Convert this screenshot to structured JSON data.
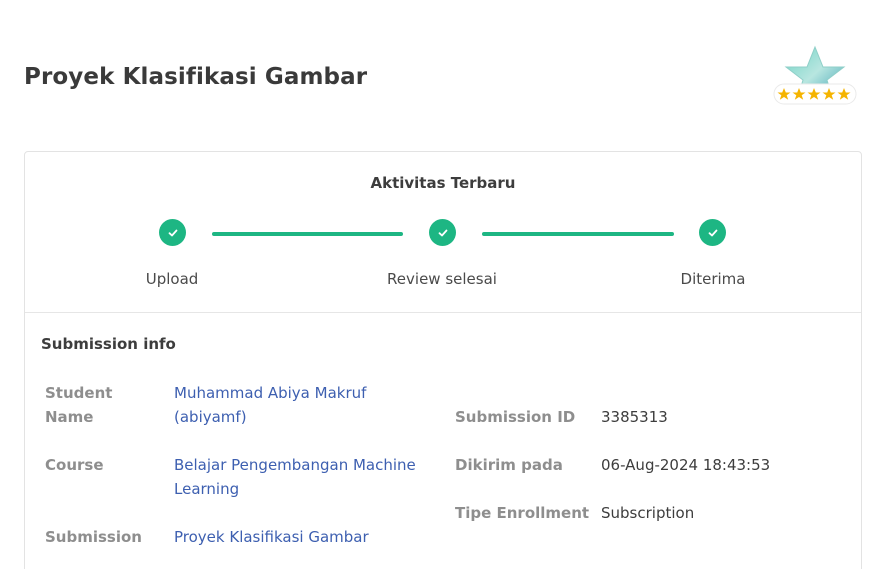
{
  "page": {
    "title": "Proyek Klasifikasi Gambar"
  },
  "badge": {
    "icon": "star-rating-badge-icon",
    "stars": 5
  },
  "activity": {
    "title": "Aktivitas Terbaru",
    "steps": [
      {
        "label": "Upload"
      },
      {
        "label": "Review selesai"
      },
      {
        "label": "Diterima"
      }
    ]
  },
  "submission_info": {
    "title": "Submission info",
    "student_name_label_1": "Student",
    "student_name_label_2": "Name",
    "student_name_value_1": "Muhammad Abiya Makruf",
    "student_name_value_2": "(abiyamf)",
    "course_label": "Course",
    "course_value_1": "Belajar Pengembangan Machine",
    "course_value_2": "Learning",
    "submission_label": "Submission",
    "submission_value": "Proyek Klasifikasi Gambar",
    "submission_id_label": "Submission ID",
    "submission_id_value": "3385313",
    "dikirim_label": "Dikirim pada",
    "dikirim_value": "06-Aug-2024 18:43:53",
    "tipe_label": "Tipe Enrollment",
    "tipe_value": "Subscription"
  },
  "colors": {
    "accent": "#1db683",
    "link": "#3d5fb0",
    "label": "#8e8e8e",
    "star": "#f5b400"
  }
}
